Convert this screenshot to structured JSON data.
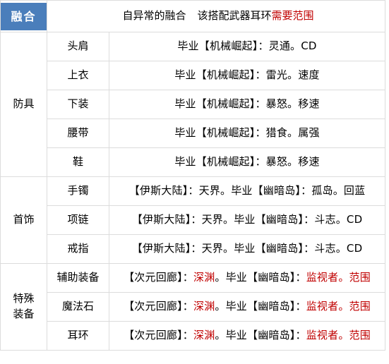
{
  "header": {
    "badge_label": "融合",
    "note_black_1": "自异常的融合",
    "note_black_2": "该搭配武器耳环",
    "note_red": "需要范围"
  },
  "columns": {
    "group_header": "融合",
    "slot_header": "",
    "desc_header": ""
  },
  "groups": [
    {
      "name": "防具",
      "name_lines": [
        "防具"
      ],
      "rows": [
        {
          "slot": "头肩",
          "desc_parts": [
            {
              "text": "毕业【机械崛起】：灵通。CD",
              "color": "black"
            }
          ],
          "desc_plain": "毕业【机械崛起】：灵通。CD"
        },
        {
          "slot": "上衣",
          "desc_parts": [
            {
              "text": "毕业【机械崛起】：雷光。速度",
              "color": "black"
            }
          ],
          "desc_plain": "毕业【机械崛起】：雷光。速度"
        },
        {
          "slot": "下装",
          "desc_parts": [
            {
              "text": "毕业【机械崛起】：暴怒。移速",
              "color": "black"
            }
          ],
          "desc_plain": "毕业【机械崛起】：暴怒。移速"
        },
        {
          "slot": "腰带",
          "desc_parts": [
            {
              "text": "毕业【机械崛起】：猎食。属强",
              "color": "black"
            }
          ],
          "desc_plain": "毕业【机械崛起】：猎食。属强"
        },
        {
          "slot": "鞋",
          "desc_parts": [
            {
              "text": "毕业【机械崛起】：暴怒。移速",
              "color": "black"
            }
          ],
          "desc_plain": "毕业【机械崛起】：暴怒。移速"
        }
      ]
    },
    {
      "name": "首饰",
      "name_lines": [
        "首饰"
      ],
      "rows": [
        {
          "slot": "手镯",
          "desc_parts": [
            {
              "text": "【伊斯大陆】：天界。毕业【幽暗岛】：孤岛。回蓝",
              "color": "black"
            }
          ],
          "desc_plain": "【伊斯大陆】：天界。毕业【幽暗岛】：孤岛。回蓝"
        },
        {
          "slot": "项链",
          "desc_parts": [
            {
              "text": "【伊斯大陆】：天界。毕业【幽暗岛】：斗志。CD",
              "color": "black"
            }
          ],
          "desc_plain": "【伊斯大陆】：天界。毕业【幽暗岛】：斗志。CD"
        },
        {
          "slot": "戒指",
          "desc_parts": [
            {
              "text": "【伊斯大陆】：天界。毕业【幽暗岛】：斗志。CD",
              "color": "black"
            }
          ],
          "desc_plain": "【伊斯大陆】：天界。毕业【幽暗岛】：斗志。CD"
        }
      ]
    },
    {
      "name": "特殊装备",
      "name_lines": [
        "特殊",
        "装备"
      ],
      "rows": [
        {
          "slot": "辅助装备",
          "desc_parts": [
            {
              "text": "【次元回廊】：",
              "color": "black"
            },
            {
              "text": "深渊",
              "color": "red"
            },
            {
              "text": "。毕业【幽暗岛】：",
              "color": "black"
            },
            {
              "text": "监视者。范围",
              "color": "red"
            }
          ],
          "desc_plain": "【次元回廊】：深渊。毕业【幽暗岛】：监视者。范围"
        },
        {
          "slot": "魔法石",
          "desc_parts": [
            {
              "text": "【次元回廊】：",
              "color": "black"
            },
            {
              "text": "深渊",
              "color": "red"
            },
            {
              "text": "。毕业【幽暗岛】：",
              "color": "black"
            },
            {
              "text": "监视者。范围",
              "color": "red"
            }
          ],
          "desc_plain": "【次元回廊】：深渊。毕业【幽暗岛】：监视者。范围"
        },
        {
          "slot": "耳环",
          "desc_parts": [
            {
              "text": "【次元回廊】：",
              "color": "black"
            },
            {
              "text": "深渊",
              "color": "red"
            },
            {
              "text": "。毕业【幽暗岛】：",
              "color": "black"
            },
            {
              "text": "监视者。范围",
              "color": "red"
            }
          ],
          "desc_plain": "【次元回廊】：深渊。毕业【幽暗岛】：监视者。范围"
        }
      ]
    }
  ],
  "colors": {
    "badge_blue": "#4a7ebb",
    "highlight_red": "#c00000",
    "grid_line": "#dcdcdc",
    "text": "#000000"
  }
}
